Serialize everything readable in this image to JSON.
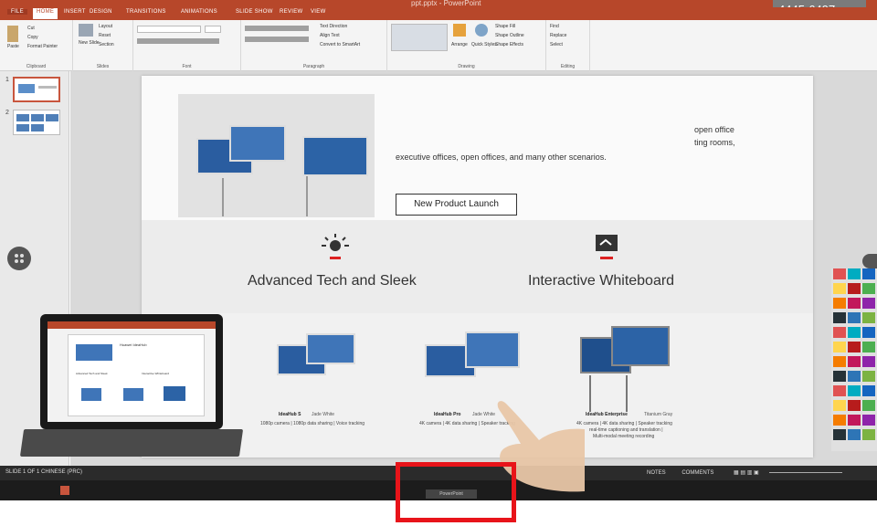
{
  "window": {
    "title": "ppt.pptx - PowerPoint",
    "phone": "4445-6497"
  },
  "tabs": [
    "FILE",
    "HOME",
    "INSERT",
    "DESIGN",
    "TRANSITIONS",
    "ANIMATIONS",
    "SLIDE SHOW",
    "REVIEW",
    "VIEW"
  ],
  "ribbon": {
    "clipboard": {
      "paste": "Paste",
      "cut": "Cut",
      "copy": "Copy",
      "format_painter": "Format Painter",
      "label": "Clipboard"
    },
    "slides": {
      "new_slide": "New Slide",
      "layout": "Layout",
      "reset": "Reset",
      "section": "Section",
      "label": "Slides"
    },
    "font": {
      "label": "Font"
    },
    "paragraph": {
      "text_direction": "Text Direction",
      "align_text": "Align Text",
      "convert": "Convert to SmartArt",
      "label": "Paragraph"
    },
    "drawing": {
      "arrange": "Arrange",
      "quick_styles": "Quick Styles",
      "shape_fill": "Shape Fill",
      "shape_outline": "Shape Outline",
      "shape_effects": "Shape Effects",
      "label": "Drawing"
    },
    "editing": {
      "find": "Find",
      "replace": "Replace",
      "select": "Select",
      "label": "Editing"
    }
  },
  "thumbnails": [
    "1",
    "2"
  ],
  "slide": {
    "desc": "executive offices, open offices, and many other scenarios.",
    "right_line1": "open office",
    "right_line2": "ting rooms,",
    "launch_button": "New Product Launch",
    "feature1": "Advanced Tech and Sleek",
    "feature2": "Interactive Whiteboard",
    "products": [
      {
        "name": "IdeaHub S",
        "color": "Jade White",
        "spec": "1080p camera | 1080p data sharing | Voice tracking"
      },
      {
        "name": "IdeaHub Pro",
        "color": "Jade White",
        "spec": "4K camera | 4K data sharing | Speaker tracking"
      },
      {
        "name": "IdeaHub Enterprise",
        "color": "Titanium Gray",
        "spec": "4K camera | 4K data sharing | Speaker tracking"
      }
    ],
    "product3_extra": "real-time captioning and translation |",
    "product3_extra2": "Multi-modal meeting recording"
  },
  "laptop": {
    "slide_title": "Huawei IdeaHub",
    "f1": "Advanced Tech and Sleek",
    "f2": "Interactive Whiteboard"
  },
  "status": {
    "left": "SLIDE 1 OF 1    CHINESE (PRC)",
    "notes": "NOTES",
    "comments": "COMMENTS"
  },
  "taskbar": {
    "label": "PowerPoint"
  },
  "swatch_colors": [
    "#e05252",
    "#4caf50",
    "#2e75b6",
    "#ffd54f",
    "#8e24aa",
    "#00acc1",
    "#f57c00",
    "#7cb342",
    "#b71c1c",
    "#263238",
    "#1565c0",
    "#c2185b"
  ]
}
